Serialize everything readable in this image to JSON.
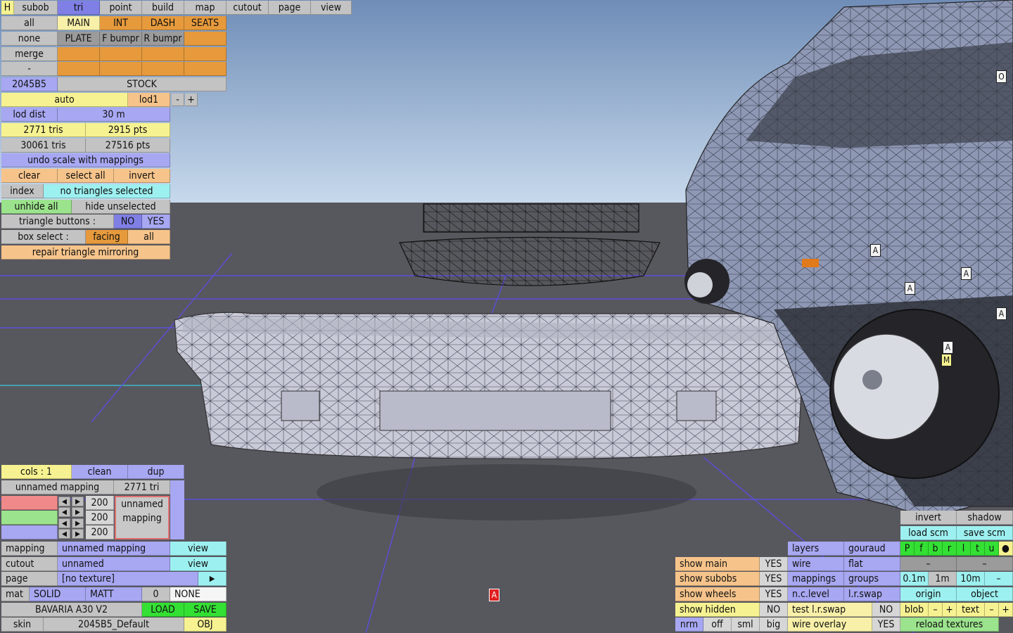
{
  "top_menu": {
    "h": "H",
    "subob": "subob",
    "tri": "tri",
    "point": "point",
    "build": "build",
    "map": "map",
    "cutout": "cutout",
    "page": "page",
    "view": "view"
  },
  "subob_groups": {
    "row1": [
      "all",
      "MAIN",
      "INT",
      "DASH",
      "SEATS"
    ],
    "row2": [
      "none",
      "PLATE",
      "F bumpr",
      "R bumpr"
    ],
    "row3": [
      "merge"
    ],
    "row4": [
      "-"
    ],
    "color": "2045B5",
    "stock": "STOCK"
  },
  "lod": {
    "mode": "auto",
    "level": "lod1",
    "minus": "-",
    "plus": "+",
    "dist_label": "lod dist",
    "dist_value": "30 m"
  },
  "stats": {
    "tris1": "2771 tris",
    "pts1": "2915 pts",
    "tris2": "30061 tris",
    "pts2": "27516 pts"
  },
  "tri_panel": {
    "undo_scale": "undo scale with mappings",
    "clear": "clear",
    "select_all": "select all",
    "invert": "invert",
    "index": "index",
    "selection_status": "no triangles selected",
    "unhide_all": "unhide all",
    "hide_unselected": "hide unselected",
    "tri_buttons_label": "triangle buttons :",
    "no": "NO",
    "yes": "YES",
    "box_select_label": "box select :",
    "facing": "facing",
    "all": "all",
    "repair": "repair triangle mirroring"
  },
  "mapping_panel": {
    "cols": "cols : 1",
    "clean": "clean",
    "dup": "dup",
    "mapping_name": "unnamed mapping",
    "tri_count": "2771 tri",
    "r": "200",
    "g": "200",
    "b": "200",
    "preview_line1": "unnamed",
    "preview_line2": "mapping",
    "arrow_left": "◀",
    "arrow_right": "▶"
  },
  "bottom_left": {
    "mapping_label": "mapping",
    "mapping_value": "unnamed mapping",
    "view1": "view",
    "cutout_label": "cutout",
    "cutout_value": "unnamed",
    "view2": "view",
    "page_label": "page",
    "page_value": "[no texture]",
    "page_arrow": "▶",
    "mat_label": "mat",
    "solid": "SOLID",
    "matt": "MATT",
    "zero": "0",
    "none": "NONE",
    "model_name": "BAVARIA A30 V2",
    "load": "LOAD",
    "save": "SAVE",
    "skin_label": "skin",
    "skin_value": "2045B5_Default",
    "obj": "OBJ"
  },
  "view_panel": {
    "show_main": "show main",
    "show_main_val": "YES",
    "show_subobs": "show subobs",
    "show_subobs_val": "YES",
    "show_wheels": "show wheels",
    "show_wheels_val": "YES",
    "show_hidden": "show hidden",
    "show_hidden_val": "NO",
    "nrm": "nrm",
    "off": "off",
    "sml": "sml",
    "big": "big",
    "layers": "layers",
    "gouraud": "gouraud",
    "wire": "wire",
    "flat": "flat",
    "mappings": "mappings",
    "groups": "groups",
    "nclevel": "n.c.level",
    "lrswap": "l.r.swap",
    "test_lrswap": "test l.r.swap",
    "test_val": "NO",
    "wire_overlay": "wire overlay",
    "wire_overlay_val": "YES",
    "invert": "invert",
    "shadow": "shadow",
    "load_scm": "load scm",
    "save_scm": "save scm",
    "flags": [
      "P",
      "f",
      "b",
      "r",
      "l",
      "t",
      "u",
      "●"
    ],
    "dash1": "–",
    "dash2": "–",
    "step1": "0.1m",
    "step2": "1m",
    "step3": "10m",
    "step_minus": "–",
    "origin": "origin",
    "object": "object",
    "blob": "blob",
    "blob_minus": "–",
    "blob_plus": "+",
    "text": "text",
    "text_minus": "–",
    "text_plus": "+",
    "reload": "reload textures"
  },
  "markers": {
    "a": "A",
    "m": "M",
    "o": "O"
  },
  "colors": {
    "sky_top": "#6f8db7",
    "sky_bottom": "#c6d8ec",
    "ground": "#57575e",
    "grid": "#5a4fd8",
    "car": "#8e98b4"
  }
}
